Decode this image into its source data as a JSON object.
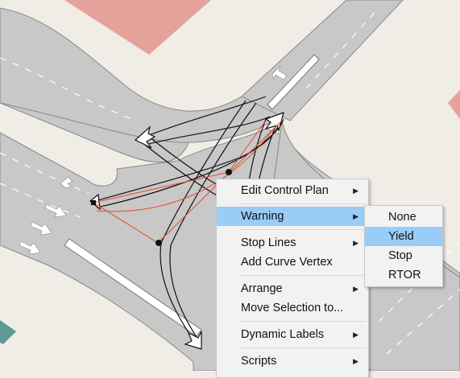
{
  "context_menu": {
    "items": [
      {
        "label": "Edit Control Plan",
        "has_submenu": true
      },
      {
        "label": "Warning",
        "has_submenu": true,
        "highlighted": true
      },
      {
        "label": "Stop Lines",
        "has_submenu": true
      },
      {
        "label": "Add Curve Vertex",
        "has_submenu": false
      },
      {
        "label": "Arrange",
        "has_submenu": true
      },
      {
        "label": "Move Selection to...",
        "has_submenu": false
      },
      {
        "label": "Dynamic Labels",
        "has_submenu": true
      },
      {
        "label": "Scripts",
        "has_submenu": true
      }
    ],
    "submenu_arrow": "▶"
  },
  "warning_submenu": {
    "items": [
      {
        "label": "None"
      },
      {
        "label": "Yield",
        "highlighted": true
      },
      {
        "label": "Stop"
      },
      {
        "label": "RTOR"
      }
    ]
  },
  "colors": {
    "background": "#efede6",
    "road": "#c8c8c8",
    "building": "#e5a29a",
    "building_teal": "#5e9a93",
    "selection_line": "#e8492e",
    "menu_highlight": "#99ccf7"
  },
  "icons": [
    "lane-arrow-icon",
    "turn-movement-arrow-icon",
    "vertex-handle-icon"
  ]
}
